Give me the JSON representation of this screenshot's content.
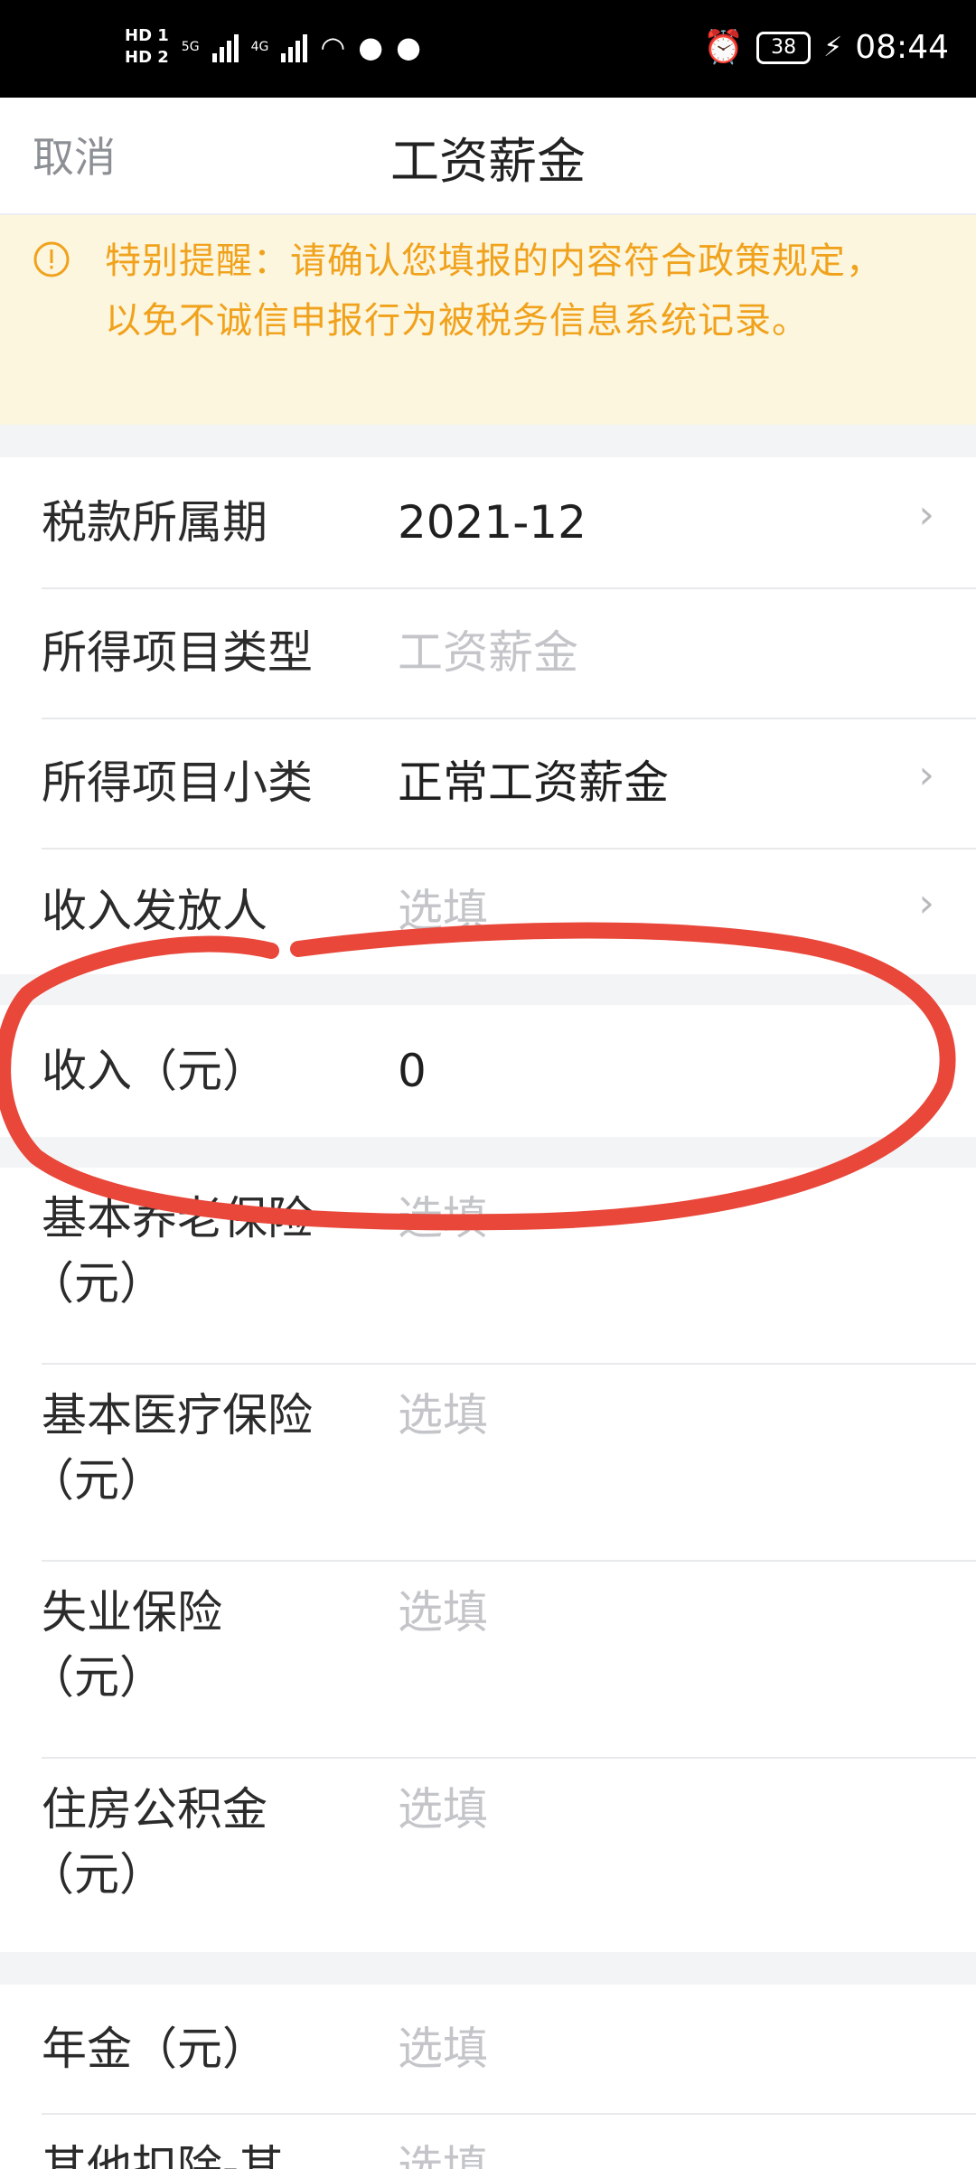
{
  "status_bar": {
    "hd1": "HD 1",
    "hd2": "HD 2",
    "net1": "5G",
    "net2": "4G",
    "battery": "38",
    "time": "08:44"
  },
  "nav": {
    "cancel": "取消",
    "title": "工资薪金"
  },
  "notice": {
    "text": "特别提醒：请确认您填报的内容符合政策规定，以免不诚信申报行为被税务信息系统记录。",
    "color": "#f0a21d"
  },
  "form": {
    "tax_period": {
      "label": "税款所属期",
      "value": "2021-12"
    },
    "income_type": {
      "label": "所得项目类型",
      "value": "工资薪金"
    },
    "income_subtype": {
      "label": "所得项目小类",
      "value": "正常工资薪金"
    },
    "payer": {
      "label": "收入发放人",
      "placeholder": "选填"
    },
    "income": {
      "label": "收入（元）",
      "value": "0"
    },
    "pension": {
      "label_line1": "基本养老保险",
      "label_line2": "（元）",
      "placeholder": "选填"
    },
    "medical": {
      "label_line1": "基本医疗保险",
      "label_line2": "（元）",
      "placeholder": "选填"
    },
    "unemployment": {
      "label_line1": "失业保险",
      "label_line2": "（元）",
      "placeholder": "选填"
    },
    "housing_fund": {
      "label_line1": "住房公积金",
      "label_line2": "（元）",
      "placeholder": "选填"
    },
    "annuity": {
      "label": "年金（元）",
      "placeholder": "选填"
    },
    "other_insurance": {
      "label": "其他扣除-其",
      "placeholder": "选填"
    }
  },
  "annotation_color": "#e8473a"
}
